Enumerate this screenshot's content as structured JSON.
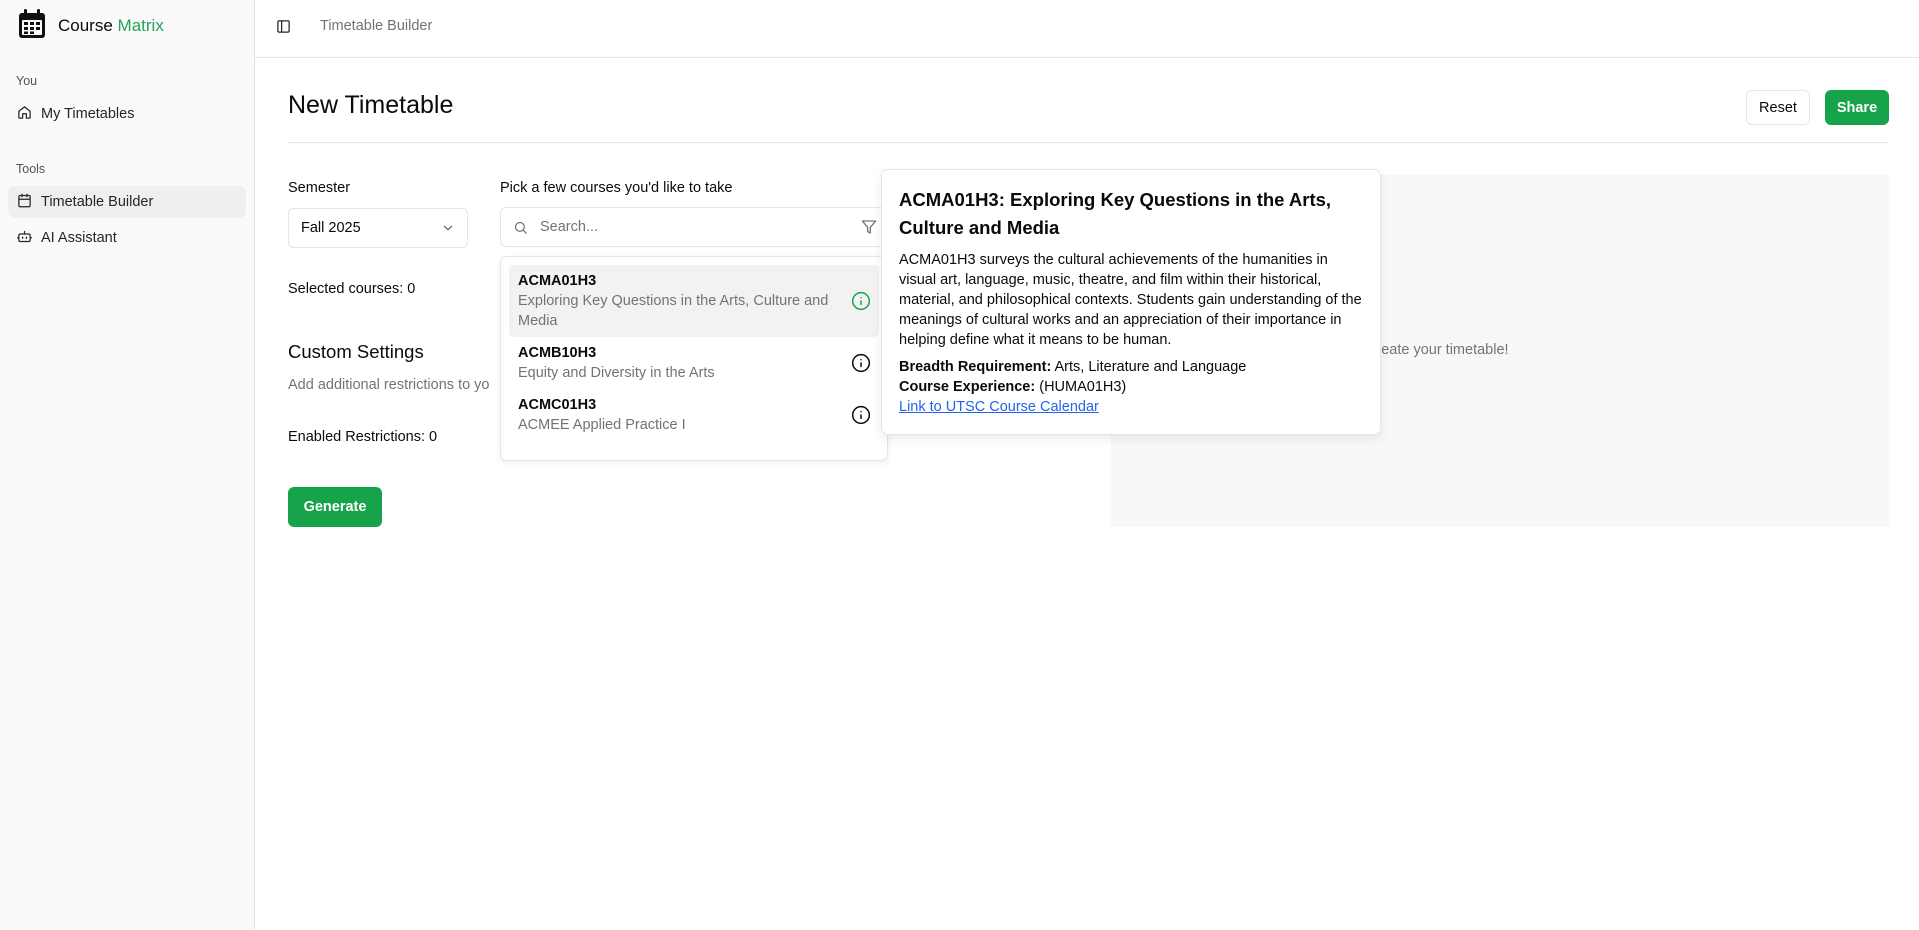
{
  "app": {
    "brand_prefix": "Course",
    "brand_accent": "Matrix",
    "accent_color": "#16a34a"
  },
  "sidebar": {
    "sections": [
      {
        "title": "You",
        "items": [
          {
            "label": "My Timetables",
            "icon": "home-icon",
            "active": false
          }
        ]
      },
      {
        "title": "Tools",
        "items": [
          {
            "label": "Timetable Builder",
            "icon": "calendar-icon",
            "active": true
          },
          {
            "label": "AI Assistant",
            "icon": "bot-icon",
            "active": false
          }
        ]
      }
    ]
  },
  "topbar": {
    "breadcrumb": "Timetable Builder"
  },
  "page": {
    "title": "New Timetable",
    "reset_label": "Reset",
    "share_label": "Share"
  },
  "form": {
    "semester_label": "Semester",
    "semester_value": "Fall 2025",
    "courses_label": "Pick a few courses you'd like to take",
    "search_placeholder": "Search...",
    "selected_courses": "Selected courses: 0",
    "custom_settings_title": "Custom Settings",
    "custom_settings_desc": "Add additional restrictions to yo",
    "enabled_restrictions": "Enabled Restrictions: 0",
    "generate_label": "Generate"
  },
  "dropdown": {
    "items": [
      {
        "code": "ACMA01H3",
        "name": "Exploring Key Questions in the Arts, Culture and Media",
        "highlighted": true
      },
      {
        "code": "ACMB10H3",
        "name": "Equity and Diversity in the Arts",
        "highlighted": false
      },
      {
        "code": "ACMC01H3",
        "name": "ACMEE Applied Practice I",
        "highlighted": false
      }
    ]
  },
  "preview": {
    "message": "ll in the form to create your timetable!"
  },
  "hovercard": {
    "title": "ACMA01H3: Exploring Key Questions in the Arts, Culture and Media",
    "description": "ACMA01H3 surveys the cultural achievements of the humanities in visual art, language, music, theatre, and film within their historical, material, and philosophical contexts. Students gain understanding of the meanings of cultural works and an appreciation of their importance in helping define what it means to be human.",
    "breadth_label": "Breadth Requirement:",
    "breadth_value": "Arts, Literature and Language",
    "experience_label": "Course Experience:",
    "experience_value": "(HUMA01H3)",
    "link_text": "Link to UTSC Course Calendar"
  }
}
